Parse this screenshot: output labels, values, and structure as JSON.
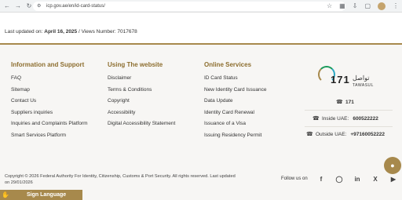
{
  "browser": {
    "url": "icp.gov.ae/en/id-card-status/"
  },
  "page": {
    "last_updated_label": "Last updated on:",
    "last_updated_value": "April 16, 2025",
    "separator": "/",
    "views_label": "Views Number:",
    "views_value": "7017678"
  },
  "footer": {
    "info": {
      "heading": "Information and Support",
      "items": [
        "FAQ",
        "Sitemap",
        "Contact Us",
        "Suppliers inquiries",
        "Inquiries and Complaints Platform",
        "Smart Services Platform"
      ]
    },
    "website": {
      "heading": "Using The website",
      "items": [
        "Disclaimer",
        "Terms & Conditions",
        "Copyright",
        "Accessibility",
        "Digital Accessibility Statement"
      ]
    },
    "online": {
      "heading": "Online Services",
      "items": [
        "ID Card Status",
        "New Identity Card Issuance",
        "Data Update",
        "Identity Card Renewal",
        "Issuance of a Visa",
        "Issuing Residency Permit"
      ]
    },
    "tawasul": {
      "logo_number": "171",
      "logo_arabic": "تواصل",
      "logo_english": "TAWASUL",
      "phone": "171",
      "inside_label": "Inside UAE:",
      "inside_value": "600522222",
      "outside_label": "Outside UAE:",
      "outside_value": "+97160052222"
    },
    "copyright": "Copyright © 2026 Federal Authority For Identity, Citizenship, Customs & Port Security. All rights reserved. Last updated on 29/01/2026",
    "follow_label": "Follow us on",
    "social": [
      "facebook-icon",
      "instagram-icon",
      "linkedin-icon",
      "x-icon",
      "youtube-icon"
    ]
  },
  "sign_language": "Sign Language",
  "colors": {
    "gold": "#a7894c",
    "heading": "#8d6e2f"
  }
}
